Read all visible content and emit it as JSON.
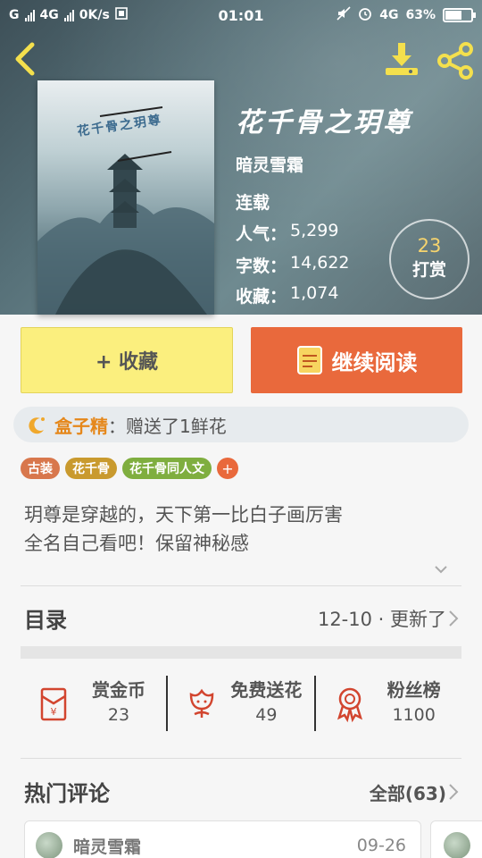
{
  "status_bar": {
    "carrier_left": "G",
    "network": "4G",
    "speed": "0K/s",
    "time": "01:01",
    "network_right": "4G",
    "battery": "63%",
    "battery_level": 0.63
  },
  "book": {
    "title": "花千骨之玥尊",
    "cover_title": "花千骨之玥尊",
    "author": "暗灵雪霜",
    "status": "连载",
    "stats": [
      {
        "key": "人气：",
        "value": "5,299"
      },
      {
        "key": "字数：",
        "value": "14,622"
      },
      {
        "key": "收藏：",
        "value": "1,074"
      }
    ],
    "reward": {
      "count": "23",
      "label": "打赏"
    }
  },
  "actions": {
    "favorite": "+ 收藏",
    "continue_reading": "继续阅读"
  },
  "gift": {
    "name": "盒子精",
    "message": "：赠送了1鲜花"
  },
  "tags": [
    {
      "label": "古装",
      "color": "#d8774c"
    },
    {
      "label": "花千骨",
      "color": "#c99a2e"
    },
    {
      "label": "花千骨同人文",
      "color": "#7fae3f"
    }
  ],
  "tag_add": "+",
  "synopsis": {
    "line1": "玥尊是穿越的，天下第一比白子画厉害",
    "line2": "全名自己看吧！保留神秘感"
  },
  "toc": {
    "label": "目录",
    "update": "12-10 · 更新了"
  },
  "stats_row": [
    {
      "label": "赏金币",
      "value": "23",
      "icon": "red-envelope-icon"
    },
    {
      "label": "免费送花",
      "value": "49",
      "icon": "flower-icon"
    },
    {
      "label": "粉丝榜",
      "value": "1100",
      "icon": "ribbon-medal-icon"
    }
  ],
  "comments": {
    "label": "热门评论",
    "all": "全部(63)",
    "first": {
      "user": "暗灵雪霜",
      "date": "09-26"
    }
  },
  "colors": {
    "accent_orange": "#e9693c",
    "favorite_yellow": "#fbef7e",
    "icon_red": "#d2452f",
    "gold": "#f6d46e"
  }
}
